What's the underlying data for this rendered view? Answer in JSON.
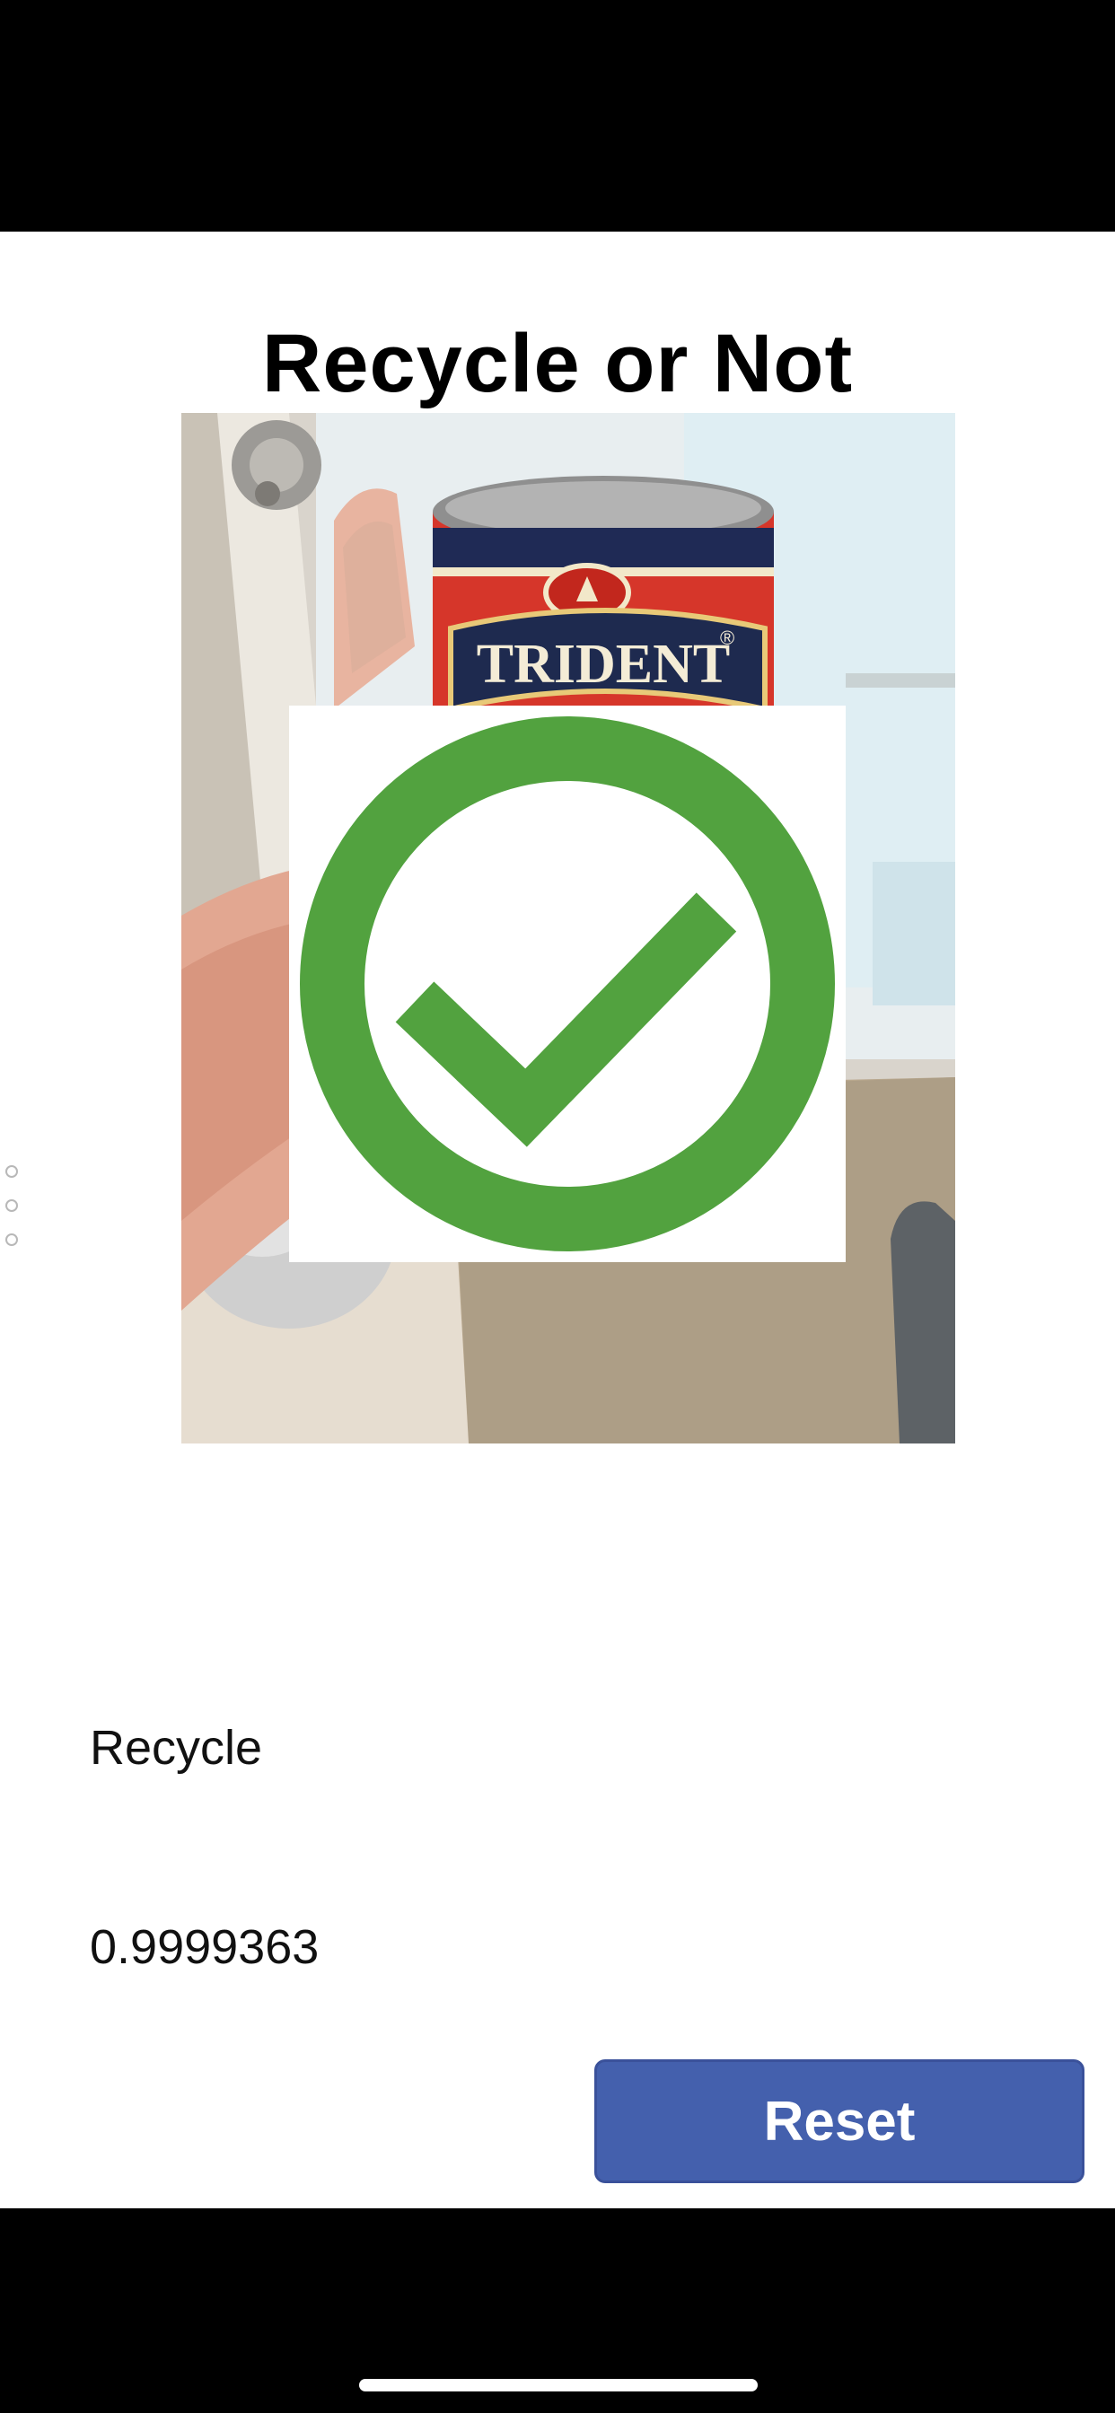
{
  "app": {
    "title": "Recycle or Not"
  },
  "photo": {
    "can_brand": "TRIDENT",
    "can_brand_mark": "®"
  },
  "result": {
    "icon": "check-circle-icon",
    "color": "#52a23f",
    "label": "Recycle",
    "score": "0.9999363"
  },
  "actions": {
    "reset_label": "Reset",
    "reset_color": "#4460ad"
  }
}
